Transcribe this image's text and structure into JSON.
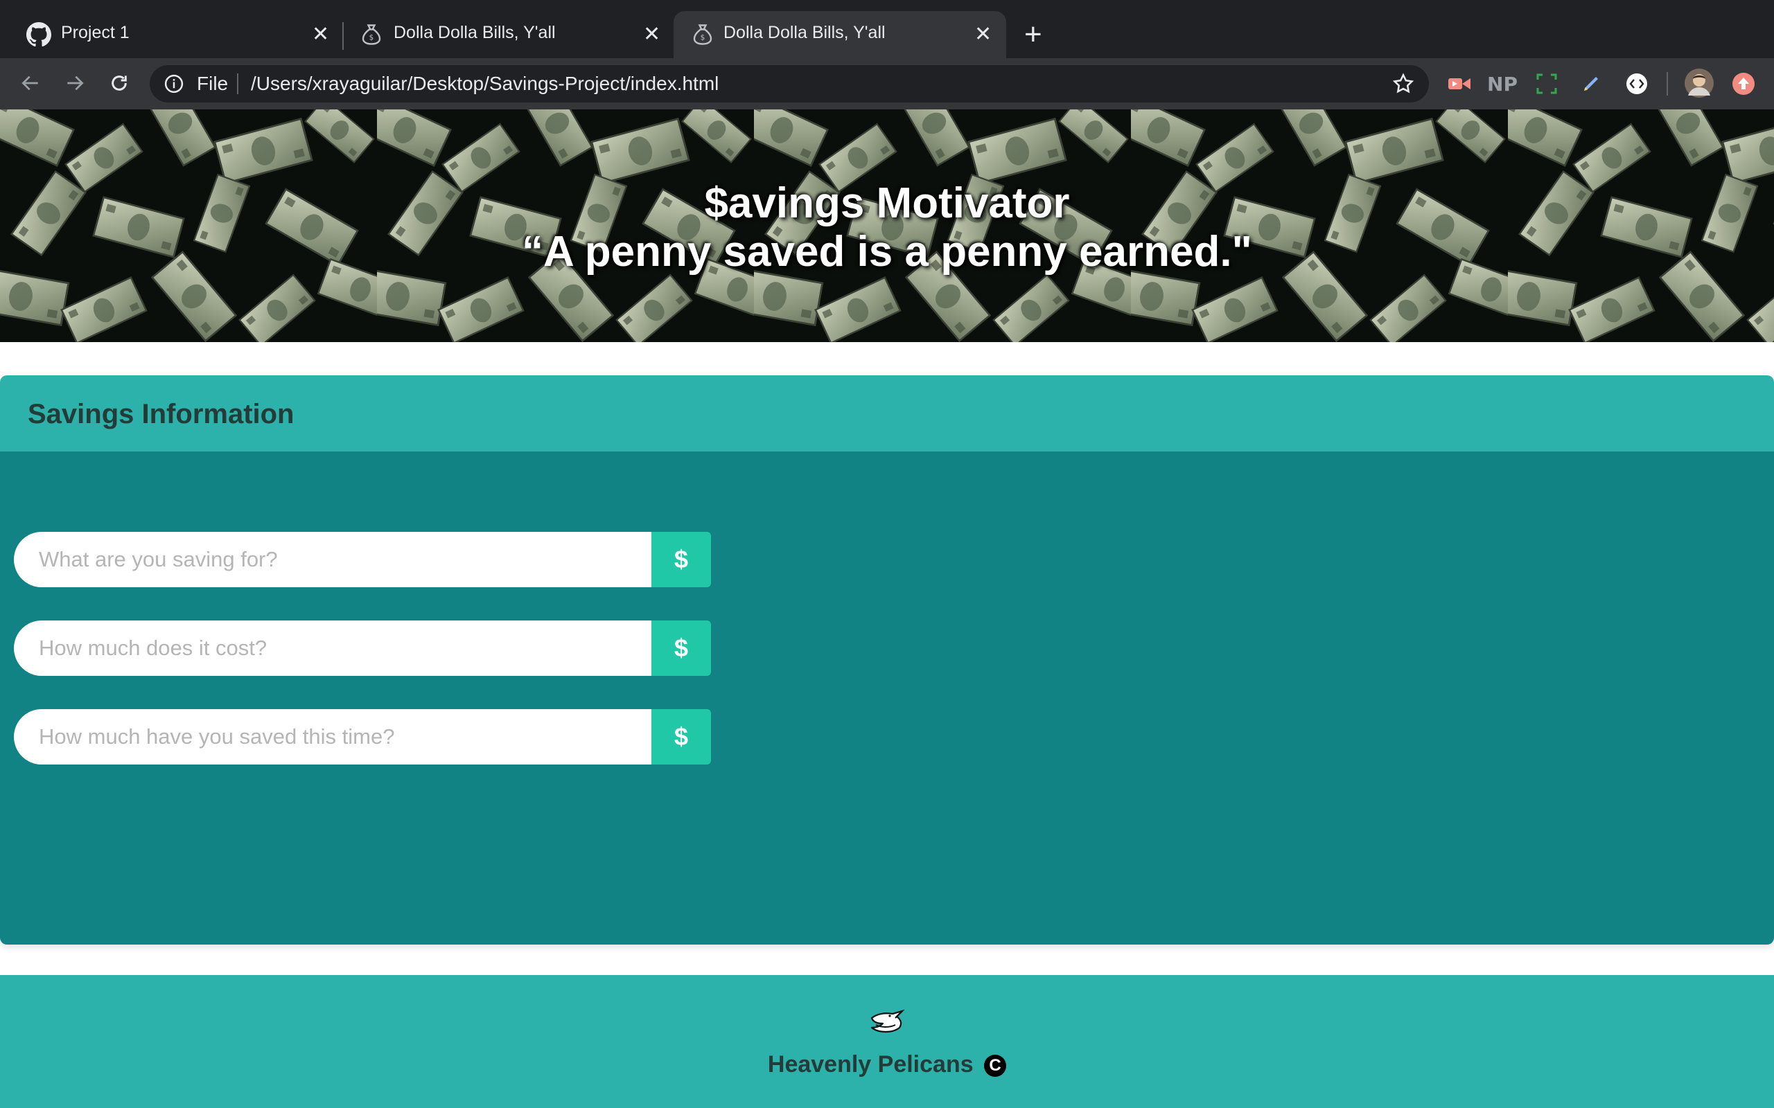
{
  "browser": {
    "tabs": [
      {
        "title": "Project 1",
        "icon": "github-icon",
        "active": false
      },
      {
        "title": "Dolla Dolla Bills, Y'all",
        "icon": "money-bag-icon",
        "active": false
      },
      {
        "title": "Dolla Dolla Bills, Y'all",
        "icon": "money-bag-icon",
        "active": true
      }
    ],
    "address": {
      "scheme": "File",
      "url": "/Users/xrayaguilar/Desktop/Savings-Project/index.html"
    },
    "extensions": [
      "video-extension-icon",
      "np-extension-icon",
      "screenshot-extension-icon",
      "pen-extension-icon",
      "code-extension-icon",
      "profile-avatar",
      "update-icon"
    ],
    "np_label": "NP"
  },
  "hero": {
    "title": "$avings Motivator",
    "quote": "“A penny saved is a penny earned.\""
  },
  "savings": {
    "header": "Savings Information",
    "fields": [
      {
        "placeholder": "What are you saving for?",
        "value": "",
        "addon": "$"
      },
      {
        "placeholder": "How much does it cost?",
        "value": "",
        "addon": "$"
      },
      {
        "placeholder": "How much have you saved this time?",
        "value": "",
        "addon": "$"
      }
    ]
  },
  "footer": {
    "brand": "Heavenly Pelicans",
    "copyright_symbol": "C",
    "logo_icon": "pelican-icon"
  },
  "colors": {
    "chrome_dark": "#202124",
    "chrome_toolbar": "#35363a",
    "teal_light": "#2db1ab",
    "teal_dark": "#118384",
    "addon_green": "#20c8a7",
    "heading_text": "#243b38"
  }
}
